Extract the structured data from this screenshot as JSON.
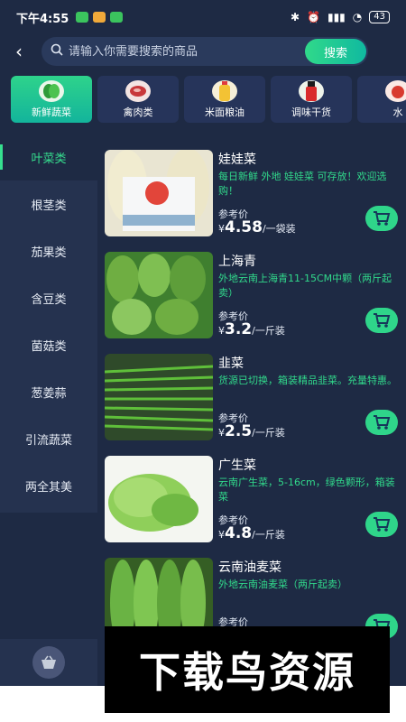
{
  "status": {
    "time": "下午4:55",
    "battery": "43"
  },
  "search": {
    "placeholder": "请输入你需要搜索的商品",
    "button": "搜索"
  },
  "categories": [
    {
      "label": "新鲜蔬菜",
      "icon": "vegetable-icon"
    },
    {
      "label": "禽肉类",
      "icon": "meat-icon"
    },
    {
      "label": "米面粮油",
      "icon": "oil-icon"
    },
    {
      "label": "调味干货",
      "icon": "seasoning-icon"
    },
    {
      "label": "水",
      "icon": "fruit-icon"
    }
  ],
  "subcategories": [
    "叶菜类",
    "根茎类",
    "茄果类",
    "含豆类",
    "菌菇类",
    "葱姜蒜",
    "引流蔬菜",
    "两全其美"
  ],
  "products": [
    {
      "name": "娃娃菜",
      "desc": "每日新鲜 外地 娃娃菜 可存放！欢迎选购！",
      "ref_label": "参考价",
      "currency": "¥",
      "price": "4.58",
      "unit": "/一袋装"
    },
    {
      "name": "上海青",
      "desc": "外地云南上海青11-15CM中颗（两斤起卖）",
      "ref_label": "参考价",
      "currency": "¥",
      "price": "3.2",
      "unit": "/一斤装"
    },
    {
      "name": "韭菜",
      "desc": "货源已切换，箱装精品韭菜。充量特惠。",
      "ref_label": "参考价",
      "currency": "¥",
      "price": "2.5",
      "unit": "/一斤装"
    },
    {
      "name": "广生菜",
      "desc": "云南广生菜，5-16cm，绿色颗形，箱装菜",
      "ref_label": "参考价",
      "currency": "¥",
      "price": "4.8",
      "unit": "/一斤装"
    },
    {
      "name": "云南油麦菜",
      "desc": "外地云南油麦菜（两斤起卖）",
      "ref_label": "参考价",
      "currency": "",
      "price": "",
      "unit": ""
    }
  ],
  "watermark": "下载鸟资源",
  "colors": {
    "background": "#1e2a44",
    "accent": "#2fd58a",
    "sidebar": "#25324f"
  }
}
